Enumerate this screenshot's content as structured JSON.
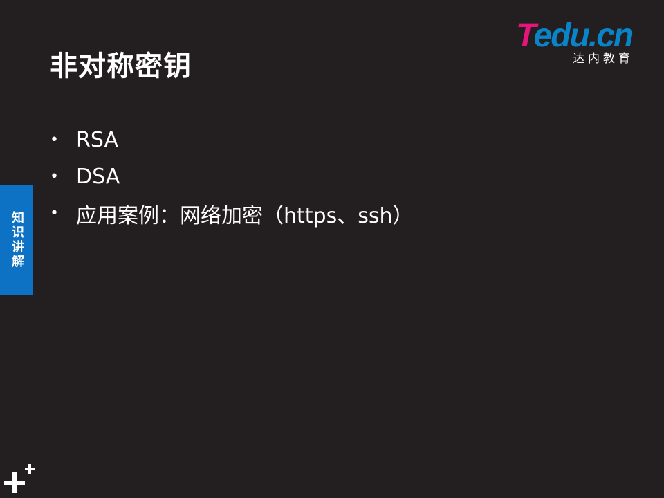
{
  "slide": {
    "title": "非对称密钥",
    "bullets": [
      "RSA",
      "DSA",
      "应用案例：网络加密（https、ssh）"
    ],
    "bullet_marker": "•"
  },
  "logo": {
    "letter_t": "T",
    "word_rest": "edu.cn",
    "subtitle": "达内教育",
    "icon": "tedu-logo-icon"
  },
  "side_tab": {
    "label": "知识讲解",
    "color": "#0d72c4"
  },
  "corner": {
    "icon": "plus-plus-icon"
  },
  "colors": {
    "background": "#231f20",
    "text": "#ffffff",
    "logo_pink": "#e6157b",
    "logo_blue": "#0a84c9"
  }
}
